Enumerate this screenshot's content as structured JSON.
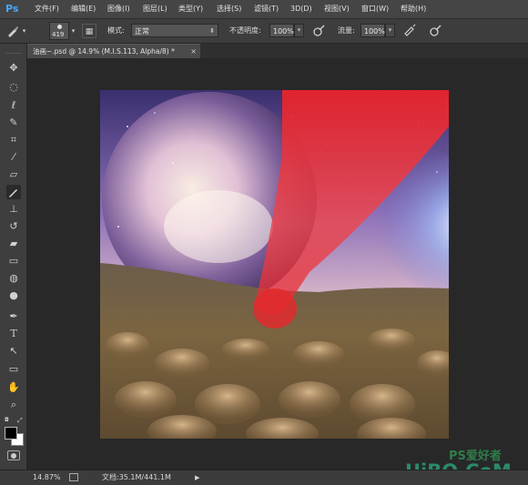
{
  "app": {
    "logo": "Ps"
  },
  "menu": [
    "文件(F)",
    "编辑(E)",
    "图像(I)",
    "图层(L)",
    "类型(Y)",
    "选择(S)",
    "滤镜(T)",
    "3D(D)",
    "视图(V)",
    "窗口(W)",
    "帮助(H)"
  ],
  "options": {
    "brush_size": "419",
    "mode_label": "模式:",
    "mode_value": "正常",
    "opacity_label": "不透明度:",
    "opacity_value": "100%",
    "flow_label": "流量:",
    "flow_value": "100%"
  },
  "document": {
    "tab_title": "油画~.psd @ 14.9% (M.I.S.113, Alpha/8) *",
    "close_glyph": "×"
  },
  "status": {
    "zoom": "14.87%",
    "doc_info": "文档:35.1M/441.1M"
  },
  "watermark": {
    "line1": "PS爱好者",
    "line2": "UiBQ.CoM"
  },
  "tools": [
    "move-icon",
    "marquee-icon",
    "lasso-icon",
    "quick-select-icon",
    "crop-icon",
    "eyedropper-icon",
    "healing-icon",
    "brush-icon",
    "stamp-icon",
    "history-brush-icon",
    "eraser-icon",
    "gradient-icon",
    "blur-icon",
    "dodge-icon",
    "pen-icon",
    "type-icon",
    "path-select-icon",
    "shape-icon",
    "hand-icon",
    "zoom-icon"
  ],
  "colors": {
    "foreground": "#000000",
    "background": "#ffffff",
    "accent": "#4aa8ff"
  }
}
